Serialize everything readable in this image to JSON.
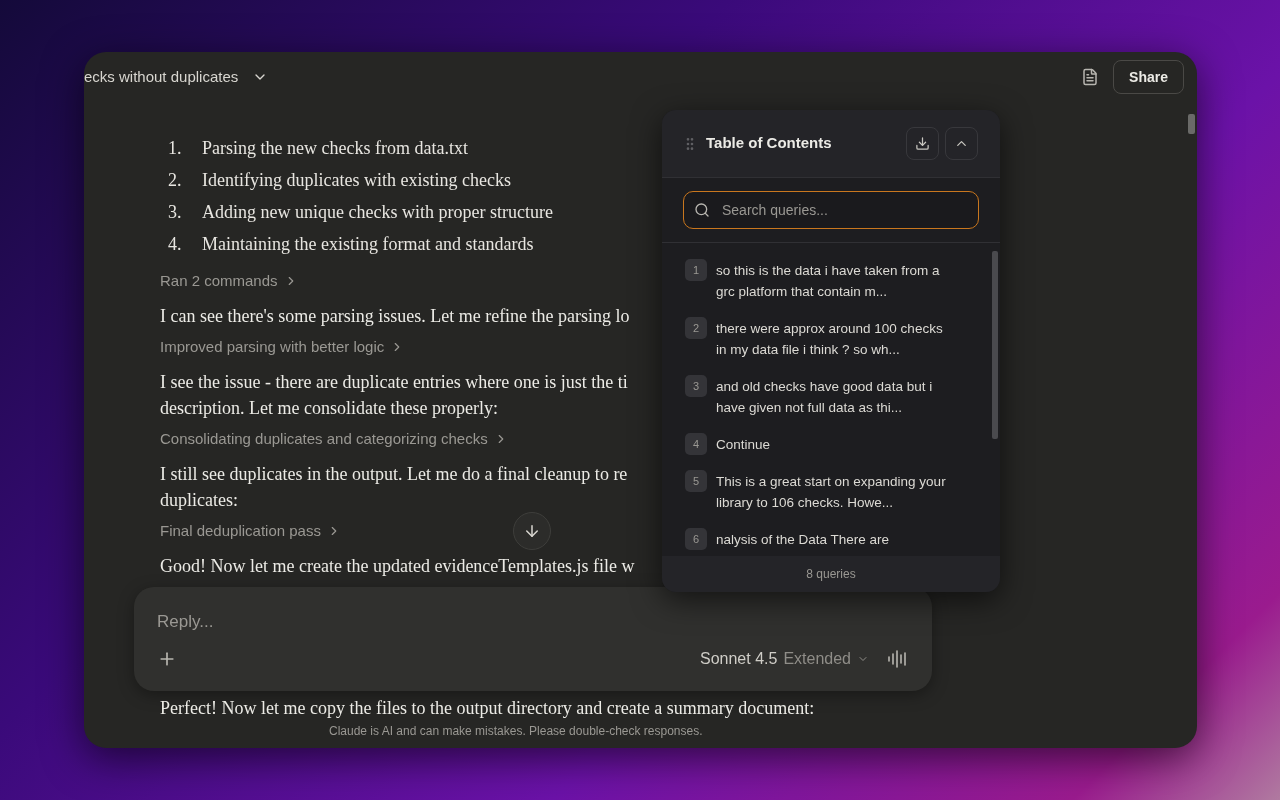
{
  "header": {
    "title": "ecks without duplicates",
    "share": "Share"
  },
  "conversation": [
    {
      "kind": "list",
      "items": [
        {
          "number": "1.",
          "text": "Parsing the new checks from data.txt"
        },
        {
          "number": "2.",
          "text": "Identifying duplicates with existing checks"
        },
        {
          "number": "3.",
          "text": "Adding new unique checks with proper structure"
        },
        {
          "number": "4.",
          "text": "Maintaining the existing format and standards"
        }
      ]
    },
    {
      "kind": "step",
      "text": "Ran 2 commands"
    },
    {
      "kind": "text",
      "lines": [
        "I can see there's some parsing issues. Let me refine the parsing lo"
      ]
    },
    {
      "kind": "step",
      "text": "Improved parsing with better logic"
    },
    {
      "kind": "text",
      "lines": [
        "I see the issue - there are duplicate entries where one is just the ti",
        "description. Let me consolidate these properly:"
      ]
    },
    {
      "kind": "step",
      "text": "Consolidating duplicates and categorizing checks"
    },
    {
      "kind": "text",
      "lines": [
        "I still see duplicates in the output. Let me do a final cleanup to re",
        "duplicates:"
      ]
    },
    {
      "kind": "step",
      "text": "Final deduplication pass"
    },
    {
      "kind": "text",
      "lines": [
        "Good! Now let me create the updated evidenceTemplates.js file w"
      ]
    }
  ],
  "reply": {
    "placeholder": "Reply...",
    "model": "Sonnet 4.5",
    "mode": "Extended"
  },
  "after_reply": "Perfect! Now let me copy the files to the output directory and create a summary document:",
  "disclaimer": "Claude is AI and can make mistakes. Please double-check responses.",
  "toc": {
    "title": "Table of Contents",
    "search_placeholder": "Search queries...",
    "items": [
      {
        "number": "1",
        "lines": [
          "so this is the data i have taken from a",
          "grc platform that contain m..."
        ]
      },
      {
        "number": "2",
        "lines": [
          "there were approx around 100 checks",
          "in my data file i think ? so wh..."
        ]
      },
      {
        "number": "3",
        "lines": [
          "and old checks have good data but i",
          "have given not full data as thi..."
        ]
      },
      {
        "number": "4",
        "lines": [
          "Continue"
        ]
      },
      {
        "number": "5",
        "lines": [
          "This is a great start on expanding your",
          "library to 106 checks. Howe..."
        ]
      },
      {
        "number": "6",
        "lines": [
          "nalysis of the Data There are"
        ]
      }
    ],
    "footer": "8 queries"
  }
}
